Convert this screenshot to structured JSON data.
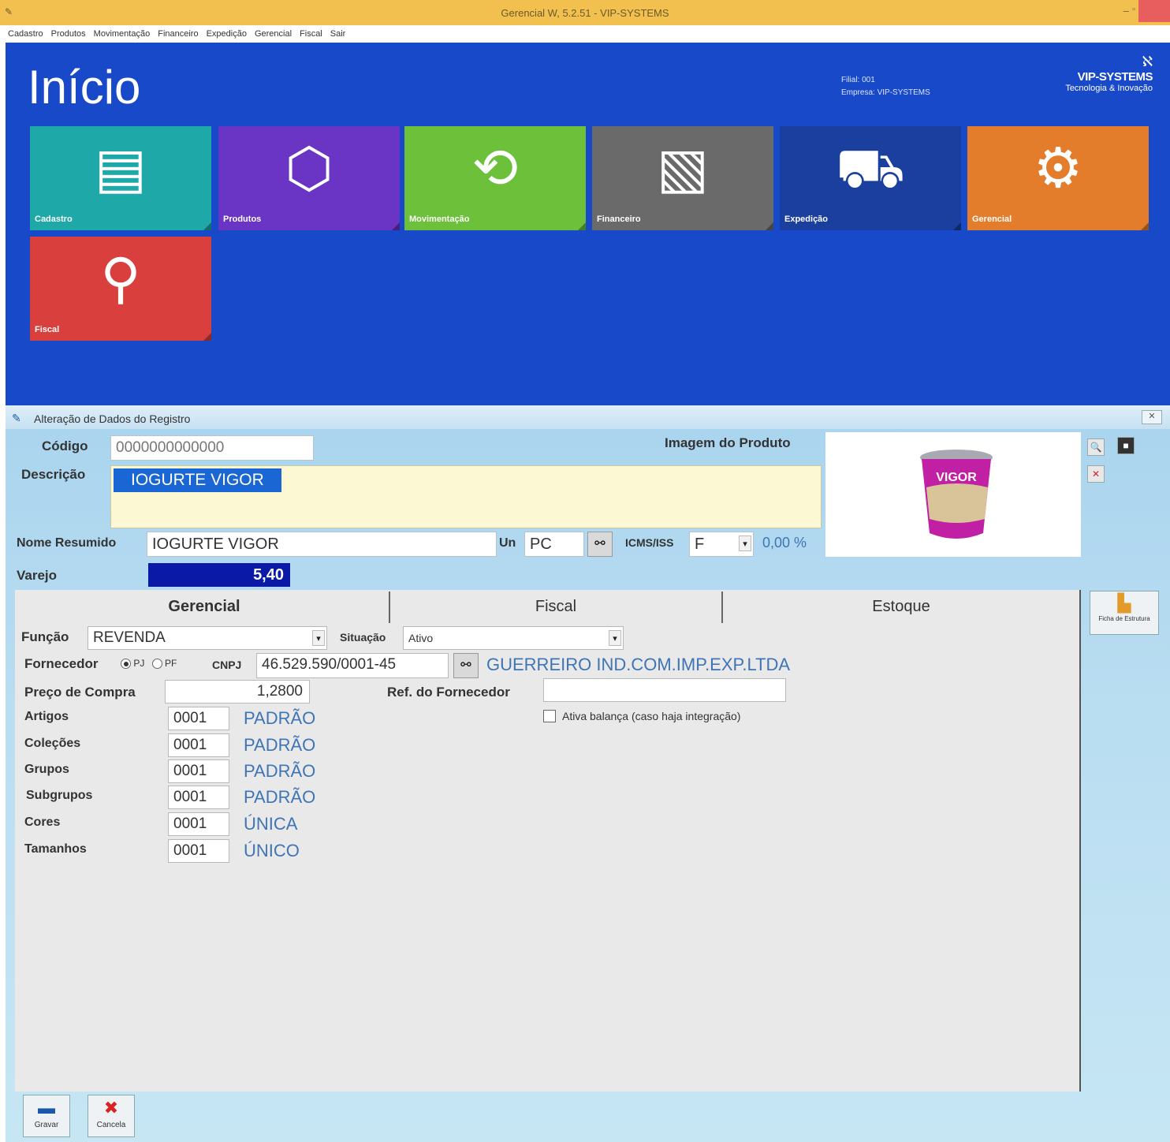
{
  "window": {
    "title": "Gerencial W, 5.2.51 - VIP-SYSTEMS",
    "minimize": "–",
    "maximize": "▫"
  },
  "menu": [
    "Cadastro",
    "Produtos",
    "Movimentação",
    "Financeiro",
    "Expedição",
    "Gerencial",
    "Fiscal",
    "Sair"
  ],
  "home": {
    "title": "Início",
    "info_line1": "Filial: 001",
    "info_line2": "Empresa: VIP-SYSTEMS",
    "brand_name": "VIP-SYSTEMS",
    "brand_tagline": "Tecnologia & Inovação",
    "tiles": [
      {
        "label": "Cadastro",
        "icon": "form-icon",
        "color": "#1fa8a8"
      },
      {
        "label": "Produtos",
        "icon": "box-icon",
        "color": "#6a34c4"
      },
      {
        "label": "Movimentação",
        "icon": "exchange-icon",
        "color": "#6cc03a"
      },
      {
        "label": "Financeiro",
        "icon": "money-icon",
        "color": "#6a6a6a"
      },
      {
        "label": "Expedição",
        "icon": "forklift-icon",
        "color": "#1a3f9e"
      },
      {
        "label": "Gerencial",
        "icon": "gear-icon",
        "color": "#e47d2b"
      },
      {
        "label": "Fiscal",
        "icon": "fiscal-icon",
        "color": "#d9403d"
      }
    ]
  },
  "dialog": {
    "title": "Alteração de Dados do Registro",
    "codigo_label": "Código",
    "codigo_value": "0000000000000",
    "descricao_label": "Descrição",
    "descricao_value": "IOGURTE VIGOR",
    "imagem_label": "Imagem do Produto",
    "nome_resumido_label": "Nome Resumido",
    "nome_resumido_value": "IOGURTE VIGOR",
    "un_label": "Un",
    "un_value": "PC",
    "icms_label": "ICMS/ISS",
    "icms_value": "F",
    "icms_pct": "0,00 %",
    "varejo_label": "Varejo",
    "varejo_value": "5,40",
    "product_brand": "VIGOR",
    "tabs": [
      "Gerencial",
      "Fiscal",
      "Estoque"
    ],
    "funcao_label": "Função",
    "funcao_value": "REVENDA",
    "situacao_label": "Situação",
    "situacao_value": "Ativo",
    "fornecedor_label": "Fornecedor",
    "pj_label": "PJ",
    "pf_label": "PF",
    "cnpj_label": "CNPJ",
    "cnpj_value": "46.529.590/0001-45",
    "fornecedor_name": "GUERREIRO IND.COM.IMP.EXP.LTDA",
    "preco_label": "Preço de Compra",
    "preco_value": "1,2800",
    "ref_label": "Ref. do Fornecedor",
    "ref_value": "",
    "balanca_label": "Ativa balança (caso haja integração)",
    "rows": [
      {
        "label": "Artigos",
        "code": "0001",
        "value": "PADRÃO"
      },
      {
        "label": "Coleções",
        "code": "0001",
        "value": "PADRÃO"
      },
      {
        "label": "Grupos",
        "code": "0001",
        "value": "PADRÃO"
      },
      {
        "label": "Subgrupos",
        "code": "0001",
        "value": "PADRÃO"
      },
      {
        "label": "Cores",
        "code": "0001",
        "value": "ÚNICA"
      },
      {
        "label": "Tamanhos",
        "code": "0001",
        "value": "ÚNICO"
      }
    ],
    "side_button": "Ficha de Estrutura",
    "gravar": "Gravar",
    "cancela": "Cancela"
  }
}
